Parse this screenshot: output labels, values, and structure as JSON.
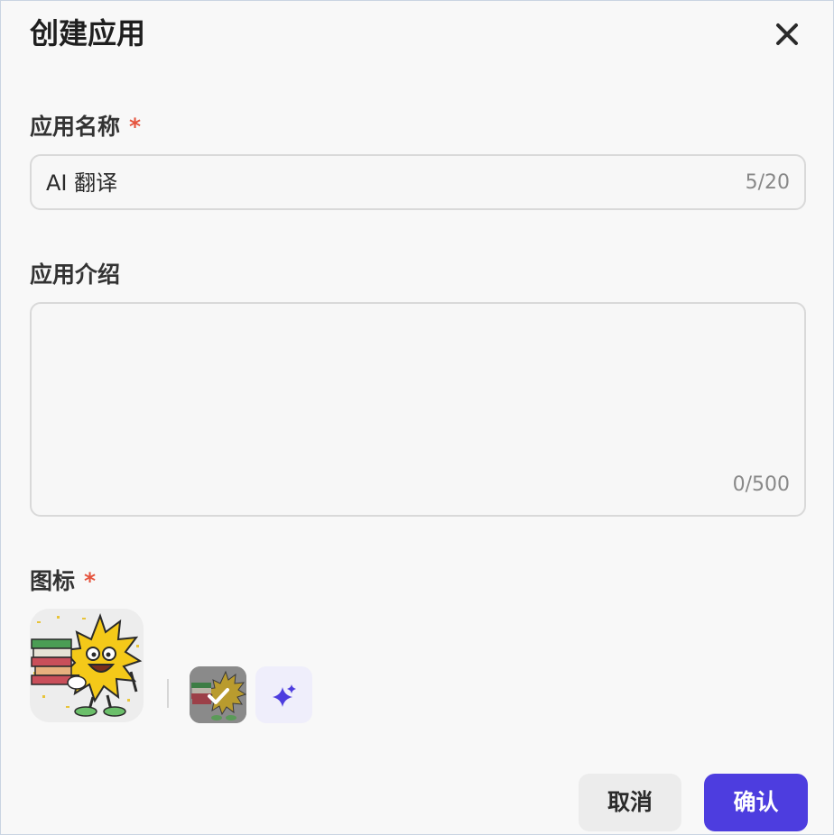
{
  "dialog": {
    "title": "创建应用",
    "close_icon": "close-icon"
  },
  "form": {
    "name": {
      "label": "应用名称",
      "required_mark": "*",
      "value": "AI 翻译",
      "count": "5/20"
    },
    "description": {
      "label": "应用介绍",
      "value": "",
      "count": "0/500"
    },
    "icon": {
      "label": "图标",
      "required_mark": "*",
      "selected_icon": "cartoon-star-with-books-icon",
      "options_icon": "cartoon-star-thumbnail-selected-icon",
      "generate_icon": "sparkle-icon"
    }
  },
  "footer": {
    "cancel_label": "取消",
    "confirm_label": "确认"
  },
  "colors": {
    "accent": "#4d3ddf",
    "required": "#e5533d",
    "ai_button_bg": "#efeefb"
  }
}
